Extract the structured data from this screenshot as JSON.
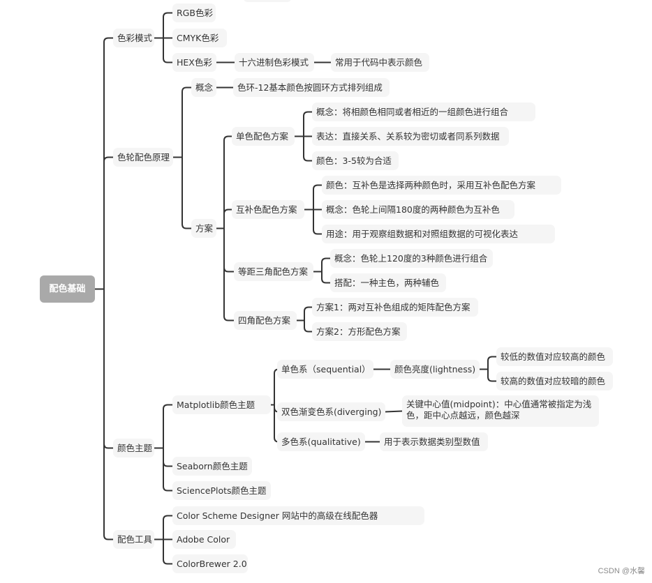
{
  "mindmap": {
    "root": {
      "id": "root",
      "label": "配色基础",
      "children": [
        {
          "id": "n1",
          "label": "色彩模式",
          "children": [
            {
              "id": "n1a",
              "label": "RGB色彩",
              "children": []
            },
            {
              "id": "n1b",
              "label": "CMYK色彩",
              "children": []
            },
            {
              "id": "n1c",
              "label": "HEX色彩",
              "children": [
                {
                  "id": "n1c1",
                  "label": "十六进制色彩模式",
                  "children": [
                    {
                      "id": "n1c1a",
                      "label": "常用于代码中表示颜色",
                      "children": []
                    }
                  ]
                }
              ]
            }
          ]
        },
        {
          "id": "n2",
          "label": "色轮配色原理",
          "children": [
            {
              "id": "n2a",
              "label": "概念",
              "children": [
                {
                  "id": "n2a1",
                  "label": "色环-12基本颜色按圆环方式排列组成",
                  "children": []
                }
              ]
            },
            {
              "id": "n2b",
              "label": "方案",
              "children": [
                {
                  "id": "n2b1",
                  "label": "单色配色方案",
                  "children": [
                    {
                      "id": "n2b1a",
                      "label": "概念：将相颜色相同或者相近的一组颜色进行组合",
                      "children": []
                    },
                    {
                      "id": "n2b1b",
                      "label": "表达：直接关系、关系较为密切或者同系列数据",
                      "children": []
                    },
                    {
                      "id": "n2b1c",
                      "label": "颜色：3-5较为合适",
                      "children": []
                    }
                  ]
                },
                {
                  "id": "n2b2",
                  "label": "互补色配色方案",
                  "children": [
                    {
                      "id": "n2b2a",
                      "label": "颜色：互补色是选择两种颜色时，采用互补色配色方案",
                      "children": []
                    },
                    {
                      "id": "n2b2b",
                      "label": "概念：色轮上间隔180度的两种颜色为互补色",
                      "children": []
                    },
                    {
                      "id": "n2b2c",
                      "label": "用途：用于观察组数据和对照组数据的可视化表达",
                      "children": []
                    }
                  ]
                },
                {
                  "id": "n2b3",
                  "label": "等距三角配色方案",
                  "children": [
                    {
                      "id": "n2b3a",
                      "label": "概念：色轮上120度的3种颜色进行组合",
                      "children": []
                    },
                    {
                      "id": "n2b3b",
                      "label": "搭配：一种主色，两种辅色",
                      "children": []
                    }
                  ]
                },
                {
                  "id": "n2b4",
                  "label": "四角配色方案",
                  "children": [
                    {
                      "id": "n2b4a",
                      "label": "方案1：两对互补色组成的矩阵配色方案",
                      "children": []
                    },
                    {
                      "id": "n2b4b",
                      "label": "方案2：方形配色方案",
                      "children": []
                    }
                  ]
                }
              ]
            }
          ]
        },
        {
          "id": "n3",
          "label": "颜色主题",
          "children": [
            {
              "id": "n3a",
              "label": "Matplotlib颜色主题",
              "children": [
                {
                  "id": "n3a1",
                  "label": "单色系（sequential）",
                  "children": [
                    {
                      "id": "n3a1a",
                      "label": "颜色亮度(lightness)",
                      "children": [
                        {
                          "id": "n3a1a1",
                          "label": "较低的数值对应较高的颜色",
                          "children": []
                        },
                        {
                          "id": "n3a1a2",
                          "label": "较高的数值对应较暗的颜色",
                          "children": []
                        }
                      ]
                    }
                  ]
                },
                {
                  "id": "n3a2",
                  "label": "双色渐变色系(diverging)",
                  "children": [
                    {
                      "id": "n3a2a",
                      "label": "关键中心值(midpoint)：中心值通常被指定为浅色，距中心点越远，颜色越深",
                      "children": []
                    }
                  ]
                },
                {
                  "id": "n3a3",
                  "label": "多色系(qualitative)",
                  "children": [
                    {
                      "id": "n3a3a",
                      "label": "用于表示数据类别型数值",
                      "children": []
                    }
                  ]
                }
              ]
            },
            {
              "id": "n3b",
              "label": "Seaborn颜色主题",
              "children": []
            },
            {
              "id": "n3c",
              "label": "SciencePlots颜色主题",
              "children": []
            }
          ]
        },
        {
          "id": "n4",
          "label": "配色工具",
          "children": [
            {
              "id": "n4a",
              "label": "Color Scheme Designer 网站中的高级在线配色器",
              "children": []
            },
            {
              "id": "n4b",
              "label": "Adobe Color",
              "children": []
            },
            {
              "id": "n4c",
              "label": "ColorBrewer 2.0",
              "children": []
            }
          ]
        }
      ]
    }
  },
  "watermark": "CSDN @水馨",
  "colors": {
    "root_bg": "#a9a9a9",
    "node_bg": "#f5f5f5",
    "line": "#333333",
    "text": "#333333"
  }
}
